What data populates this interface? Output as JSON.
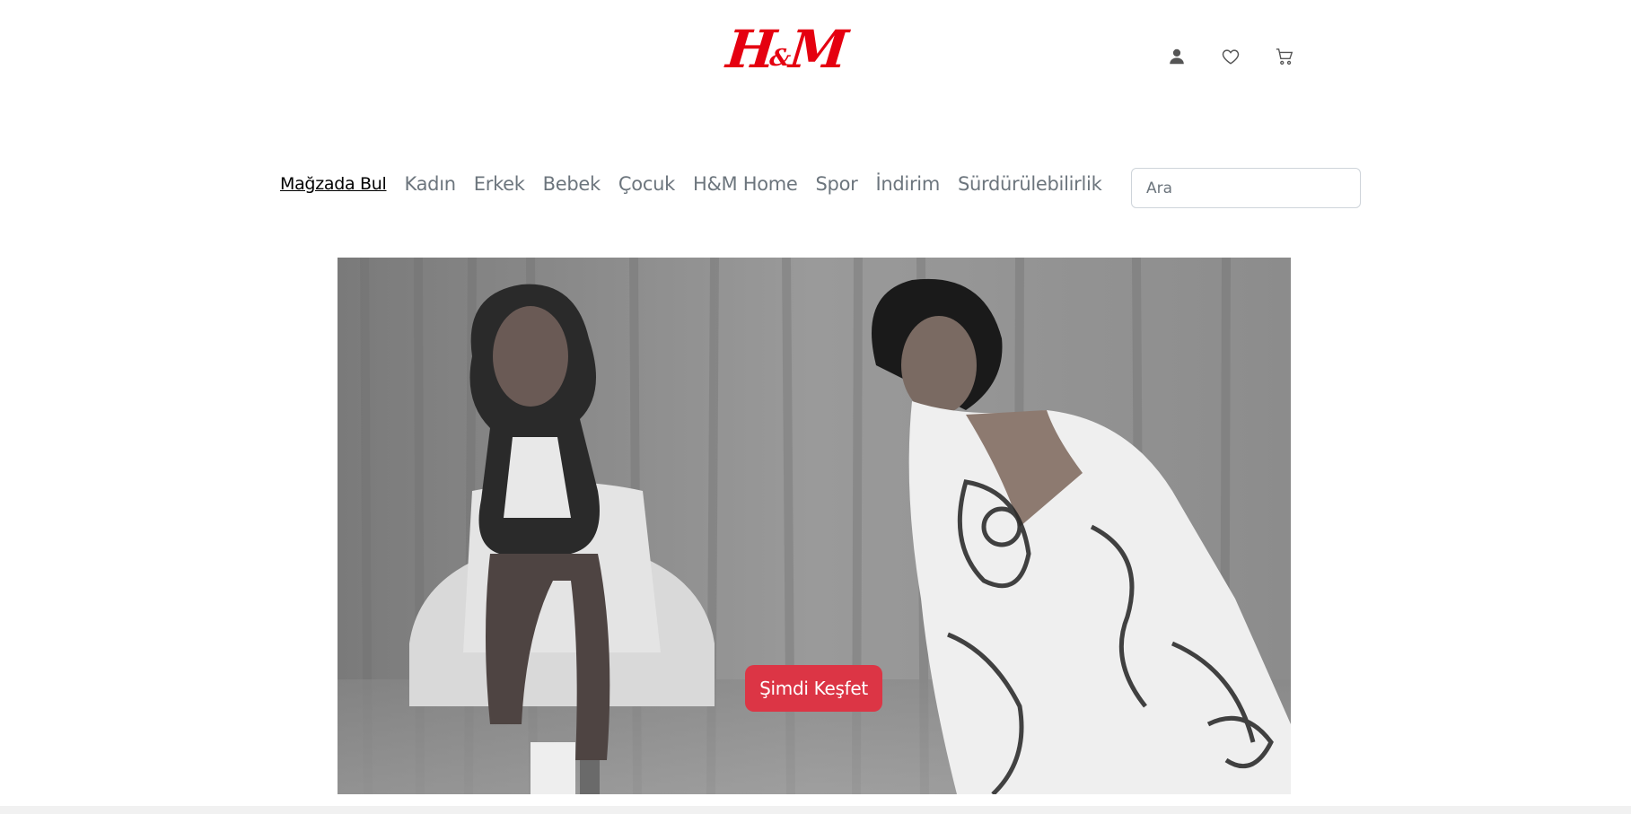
{
  "brand": {
    "logo_text_h": "H",
    "logo_text_amp": "&",
    "logo_text_m": "M",
    "logo_alt": "H&M",
    "color": "#e50010"
  },
  "header": {
    "icons": [
      "user-icon",
      "heart-icon",
      "cart-icon"
    ]
  },
  "nav": {
    "items": [
      {
        "label": "Mağzada Bul",
        "active": true
      },
      {
        "label": "Kadın",
        "active": false
      },
      {
        "label": "Erkek",
        "active": false
      },
      {
        "label": "Bebek",
        "active": false
      },
      {
        "label": "Çocuk",
        "active": false
      },
      {
        "label": "H&M Home",
        "active": false
      },
      {
        "label": "Spor",
        "active": false
      },
      {
        "label": "İndirim",
        "active": false
      },
      {
        "label": "Sürdürülebilirlik",
        "active": false
      }
    ]
  },
  "search": {
    "placeholder": "Ara",
    "value": ""
  },
  "hero": {
    "cta_label": "Şimdi Keşfet",
    "cta_color": "#dc3545"
  }
}
